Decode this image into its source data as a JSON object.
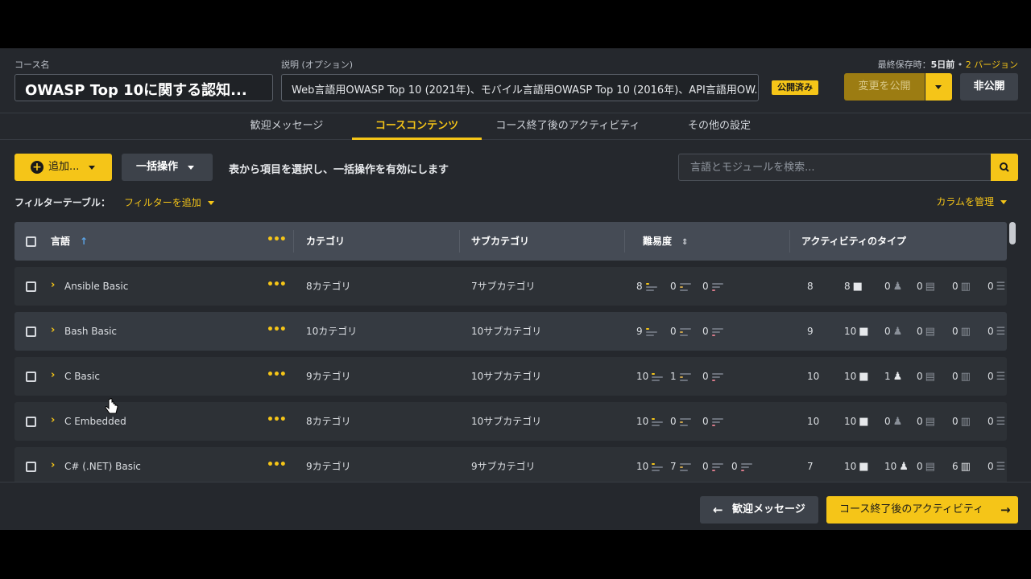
{
  "header": {
    "course_name_label": "コース名",
    "course_name_value": "OWASP Top 10に関する認知...",
    "description_label": "説明 (オプション)",
    "description_value": "Web言語用OWASP Top 10 (2021年)、モバイル言語用OWASP Top 10 (2016年)、API言語用OW...",
    "status_badge": "公開済み",
    "last_saved_prefix": "最終保存時：",
    "last_saved_time": "5日前",
    "versions_sep": " • ",
    "versions_link": "2 バージョン",
    "publish_label": "変更を公開",
    "private_label": "非公開"
  },
  "tabs": [
    {
      "label": "歓迎メッセージ"
    },
    {
      "label": "コースコンテンツ"
    },
    {
      "label": "コース終了後のアクティビティ"
    },
    {
      "label": "その他の設定"
    }
  ],
  "toolbar": {
    "add_label": "追加...",
    "bulk_label": "一括操作",
    "bulk_hint": "表から項目を選択し、一括操作を有効にします",
    "search_placeholder": "言語とモジュールを検索..."
  },
  "filter": {
    "label": "フィルターテーブル：",
    "add_label": "フィルターを追加",
    "manage_columns": "カラムを管理"
  },
  "table": {
    "headers": {
      "language": "言語",
      "category": "カテゴリ",
      "subcategory": "サブカテゴリ",
      "difficulty": "難易度",
      "activity_type": "アクティビティのタイプ"
    },
    "rows": [
      {
        "name": "Ansible Basic",
        "category": "8カテゴリ",
        "subcategory": "7サブカテゴリ",
        "diff": [
          "8",
          "0",
          "0"
        ],
        "acts": [
          "8",
          "8",
          "0",
          "0",
          "0",
          "0"
        ]
      },
      {
        "name": "Bash Basic",
        "category": "10カテゴリ",
        "subcategory": "10サブカテゴリ",
        "diff": [
          "9",
          "0",
          "0"
        ],
        "acts": [
          "9",
          "10",
          "0",
          "0",
          "0",
          "0"
        ]
      },
      {
        "name": "C Basic",
        "category": "9カテゴリ",
        "subcategory": "10サブカテゴリ",
        "diff": [
          "10",
          "1",
          "0"
        ],
        "acts": [
          "10",
          "10",
          "1",
          "0",
          "0",
          "0"
        ]
      },
      {
        "name": "C Embedded",
        "category": "8カテゴリ",
        "subcategory": "10サブカテゴリ",
        "diff": [
          "10",
          "0",
          "0"
        ],
        "acts": [
          "10",
          "10",
          "0",
          "0",
          "0",
          "0"
        ]
      },
      {
        "name": "C# (.NET) Basic",
        "category": "9カテゴリ",
        "subcategory": "9サブカテゴリ",
        "diff": [
          "10",
          "7",
          "0",
          "0"
        ],
        "acts": [
          "7",
          "10",
          "10",
          "0",
          "6",
          "0"
        ]
      }
    ]
  },
  "footer": {
    "prev_label": "歓迎メッセージ",
    "next_label": "コース終了後のアクティビティ"
  },
  "colors": {
    "accent": "#f5c518",
    "bg": "#25282d",
    "header_row": "#454b55",
    "row": "#2d3136",
    "diff_easy": "#f5c518",
    "diff_medium": "#c9a24a",
    "diff_hard": "#d77a8a"
  }
}
